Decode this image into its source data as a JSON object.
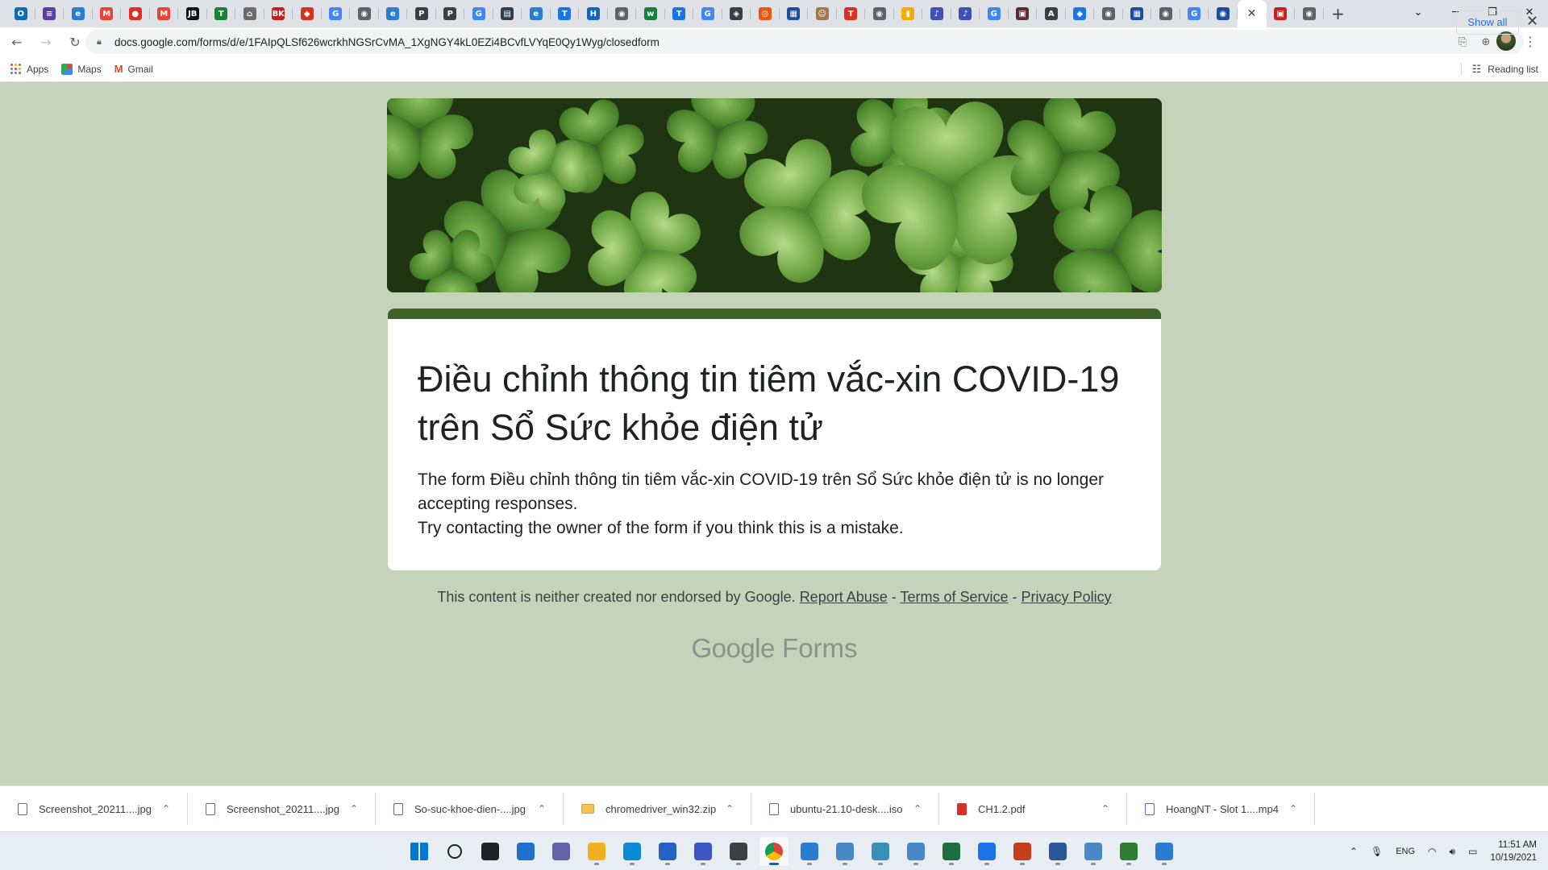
{
  "browser": {
    "url": "docs.google.com/forms/d/e/1FAIpQLSf626wcrkhNGSrCvMA_1XgNGY4kL0EZi4BCvfLVYqE0Qy1Wyg/closedform",
    "tabs": [
      {
        "icon": "outlook-icon",
        "color": "#0f6cbd",
        "glyph": "O"
      },
      {
        "icon": "notes-icon",
        "color": "#5b3ea8",
        "glyph": "≡"
      },
      {
        "icon": "edge-icon",
        "color": "#2b7cd3",
        "glyph": "e"
      },
      {
        "icon": "gmail-icon",
        "color": "#ea4335",
        "glyph": "M"
      },
      {
        "icon": "record-icon",
        "color": "#d93025",
        "glyph": "●"
      },
      {
        "icon": "gmail-icon",
        "color": "#ea4335",
        "glyph": "M"
      },
      {
        "icon": "jetbrains-icon",
        "color": "#111111",
        "glyph": "JB"
      },
      {
        "icon": "sheets-icon",
        "color": "#188038",
        "glyph": "T"
      },
      {
        "icon": "home-icon",
        "color": "#6b6b6b",
        "glyph": "⌂"
      },
      {
        "icon": "bk-icon",
        "color": "#c5221f",
        "glyph": "BK"
      },
      {
        "icon": "pin-icon",
        "color": "#d93025",
        "glyph": "◆"
      },
      {
        "icon": "google-icon",
        "color": "#4285f4",
        "glyph": "G"
      },
      {
        "icon": "globe-icon",
        "color": "#5f6368",
        "glyph": "◉"
      },
      {
        "icon": "edge-icon",
        "color": "#2b7cd3",
        "glyph": "e"
      },
      {
        "icon": "p-icon",
        "color": "#3c4043",
        "glyph": "P"
      },
      {
        "icon": "p-icon",
        "color": "#3c4043",
        "glyph": "P"
      },
      {
        "icon": "google-icon",
        "color": "#4285f4",
        "glyph": "G"
      },
      {
        "icon": "sdk-icon",
        "color": "#2c3e50",
        "glyph": "▤"
      },
      {
        "icon": "edge-icon",
        "color": "#2b7cd3",
        "glyph": "e"
      },
      {
        "icon": "tool-icon",
        "color": "#1a73e8",
        "glyph": "T"
      },
      {
        "icon": "h-icon",
        "color": "#1565c0",
        "glyph": "H"
      },
      {
        "icon": "globe-icon",
        "color": "#5f6368",
        "glyph": "◉"
      },
      {
        "icon": "w-icon",
        "color": "#188038",
        "glyph": "w"
      },
      {
        "icon": "t-icon",
        "color": "#1a73e8",
        "glyph": "T"
      },
      {
        "icon": "google-icon",
        "color": "#4285f4",
        "glyph": "G"
      },
      {
        "icon": "diamond-icon",
        "color": "#3c4043",
        "glyph": "◈"
      },
      {
        "icon": "ring-icon",
        "color": "#e8590c",
        "glyph": "◎"
      },
      {
        "icon": "news-icon",
        "color": "#1a4f9c",
        "glyph": "▦"
      },
      {
        "icon": "avatar-icon",
        "color": "#a07850",
        "glyph": "☺"
      },
      {
        "icon": "t-icon",
        "color": "#d93025",
        "glyph": "T"
      },
      {
        "icon": "globe-icon",
        "color": "#5f6368",
        "glyph": "◉"
      },
      {
        "icon": "chart-icon",
        "color": "#f9ab00",
        "glyph": "▮"
      },
      {
        "icon": "note-icon",
        "color": "#3f51b5",
        "glyph": "♪"
      },
      {
        "icon": "note-icon",
        "color": "#3f51b5",
        "glyph": "♪"
      },
      {
        "icon": "google-icon",
        "color": "#4285f4",
        "glyph": "G"
      },
      {
        "icon": "doc-icon",
        "color": "#5a2e2e",
        "glyph": "▣"
      },
      {
        "icon": "a-icon",
        "color": "#3c4043",
        "glyph": "A"
      },
      {
        "icon": "diamond-icon",
        "color": "#1a73e8",
        "glyph": "◆"
      },
      {
        "icon": "globe-icon",
        "color": "#5f6368",
        "glyph": "◉"
      },
      {
        "icon": "grid-icon",
        "color": "#1a4f9c",
        "glyph": "▦"
      },
      {
        "icon": "globe-icon",
        "color": "#5f6368",
        "glyph": "◉"
      },
      {
        "icon": "google-icon",
        "color": "#4285f4",
        "glyph": "G"
      },
      {
        "icon": "shield-icon",
        "color": "#1a4f9c",
        "glyph": "◉"
      }
    ],
    "tabs_after": [
      {
        "icon": "badge-icon",
        "color": "#c5221f",
        "glyph": "▣"
      },
      {
        "icon": "globe-icon",
        "color": "#5f6368",
        "glyph": "◉"
      }
    ],
    "bookmarks": [
      {
        "label": "Apps",
        "icon": "apps-grid-icon"
      },
      {
        "label": "Maps",
        "icon": "maps-icon"
      },
      {
        "label": "Gmail",
        "icon": "gmail-icon"
      }
    ],
    "reading_list": "Reading list"
  },
  "form": {
    "title": "Điều chỉnh thông tin tiêm vắc-xin COVID-19 trên Sổ Sức khỏe điện tử",
    "message_line1": "The form Điều chỉnh thông tin tiêm vắc-xin COVID-19 trên Sổ Sức khỏe điện tử is no longer accepting responses.",
    "message_line2": "Try contacting the owner of the form if you think this is a mistake.",
    "accent_color": "#3f6326",
    "background_color": "#c5d3bb"
  },
  "footer": {
    "disclaimer": "This content is neither created nor endorsed by Google.",
    "report_abuse": "Report Abuse",
    "separator": "-",
    "terms": "Terms of Service",
    "privacy": "Privacy Policy",
    "logo_google": "Google",
    "logo_forms": "Forms"
  },
  "downloads": {
    "items": [
      {
        "name": "Screenshot_20211....jpg",
        "type": "image"
      },
      {
        "name": "Screenshot_20211....jpg",
        "type": "image"
      },
      {
        "name": "So-suc-khoe-dien-....jpg",
        "type": "image"
      },
      {
        "name": "chromedriver_win32.zip",
        "type": "zip"
      },
      {
        "name": "ubuntu-21.10-desk....iso",
        "type": "file"
      },
      {
        "name": "CH1.2.pdf",
        "type": "pdf"
      },
      {
        "name": "HoangNT - Slot 1....mp4",
        "type": "video"
      }
    ],
    "show_all": "Show all"
  },
  "taskbar": {
    "apps": [
      {
        "name": "start-icon",
        "color": "#0078d4"
      },
      {
        "name": "search-icon",
        "color": "#202124"
      },
      {
        "name": "task-view-icon",
        "color": "#202124"
      },
      {
        "name": "widgets-icon",
        "color": "#1f6fd1"
      },
      {
        "name": "teams-chat-icon",
        "color": "#6264a7"
      },
      {
        "name": "file-explorer-icon",
        "color": "#f2b01e"
      },
      {
        "name": "edge-icon",
        "color": "#0c8ad8"
      },
      {
        "name": "store-icon",
        "color": "#2461c8"
      },
      {
        "name": "save-icon",
        "color": "#3a56c4"
      },
      {
        "name": "cube-icon",
        "color": "#3c4043"
      },
      {
        "name": "chrome-icon",
        "color": "#db4437"
      },
      {
        "name": "remote-desktop-icon",
        "color": "#2b7cd3"
      },
      {
        "name": "network-icon",
        "color": "#4a88c7"
      },
      {
        "name": "globe-app-icon",
        "color": "#3a8fb7"
      },
      {
        "name": "network-icon",
        "color": "#4a88c7"
      },
      {
        "name": "excel-icon",
        "color": "#1d6f42"
      },
      {
        "name": "notepad-icon",
        "color": "#1a73e8"
      },
      {
        "name": "powerpoint-icon",
        "color": "#c43e1c"
      },
      {
        "name": "word-icon",
        "color": "#2b579a"
      },
      {
        "name": "settings-network-icon",
        "color": "#4a88c7"
      },
      {
        "name": "tools-icon",
        "color": "#2e7d32"
      },
      {
        "name": "monitor-icon",
        "color": "#2b7cd3"
      }
    ],
    "language": "ENG",
    "time": "11:51 AM",
    "date": "10/19/2021"
  }
}
